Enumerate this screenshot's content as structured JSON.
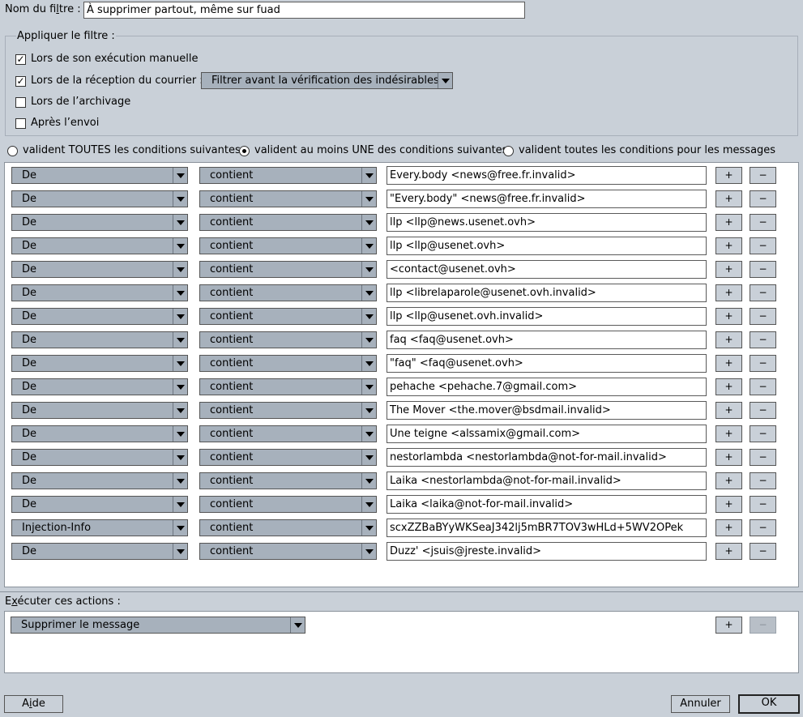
{
  "filter_name": {
    "label": "Nom du filtre :",
    "value": "À supprimer partout, même sur fuad"
  },
  "apply": {
    "title": "Appliquer le filtre :",
    "options": [
      {
        "label": "Lors de son exécution manuelle",
        "checked": true
      },
      {
        "label": "Lors de la réception du courrier :",
        "checked": true
      },
      {
        "label": "Lors de l’archivage",
        "checked": false
      },
      {
        "label": "Après l’envoi",
        "checked": false
      }
    ],
    "reception_mode": "Filtrer avant la vérification des indésirables"
  },
  "match": {
    "options": [
      {
        "label": "valident TOUTES les conditions suivantes",
        "selected": false
      },
      {
        "label": "valident au moins UNE des conditions suivantes",
        "selected": true
      },
      {
        "label": "valident toutes les conditions pour les messages",
        "selected": false
      }
    ]
  },
  "rules": [
    {
      "field": "De",
      "op": "contient",
      "value": "Every.body <news@free.fr.invalid>"
    },
    {
      "field": "De",
      "op": "contient",
      "value": "\"Every.body\" <news@free.fr.invalid>"
    },
    {
      "field": "De",
      "op": "contient",
      "value": "llp <llp@news.usenet.ovh>"
    },
    {
      "field": "De",
      "op": "contient",
      "value": "llp <llp@usenet.ovh>"
    },
    {
      "field": "De",
      "op": "contient",
      "value": "<contact@usenet.ovh>"
    },
    {
      "field": "De",
      "op": "contient",
      "value": "llp <librelaparole@usenet.ovh.invalid>"
    },
    {
      "field": "De",
      "op": "contient",
      "value": "llp <llp@usenet.ovh.invalid>"
    },
    {
      "field": "De",
      "op": "contient",
      "value": "faq <faq@usenet.ovh>"
    },
    {
      "field": "De",
      "op": "contient",
      "value": "\"faq\" <faq@usenet.ovh>"
    },
    {
      "field": "De",
      "op": "contient",
      "value": "pehache <pehache.7@gmail.com>"
    },
    {
      "field": "De",
      "op": "contient",
      "value": "The Mover <the.mover@bsdmail.invalid>"
    },
    {
      "field": "De",
      "op": "contient",
      "value": "Une teigne <alssamix@gmail.com>"
    },
    {
      "field": "De",
      "op": "contient",
      "value": "nestorlambda <nestorlambda@not-for-mail.invalid>"
    },
    {
      "field": "De",
      "op": "contient",
      "value": "Laika <nestorlambda@not-for-mail.invalid>"
    },
    {
      "field": "De",
      "op": "contient",
      "value": "Laika <laika@not-for-mail.invalid>"
    },
    {
      "field": "Injection-Info",
      "op": "contient",
      "value": "scxZZBaBYyWKSeaJ342lj5mBR7TOV3wHLd+5WV2OPek"
    },
    {
      "field": "De",
      "op": "contient",
      "value": "Duzz' <jsuis@jreste.invalid>"
    }
  ],
  "rule_buttons": {
    "add": "+",
    "remove": "−"
  },
  "actions": {
    "title": "Exécuter ces actions :",
    "items": [
      {
        "action": "Supprimer le message"
      }
    ]
  },
  "footer": {
    "help": "Aide",
    "cancel": "Annuler",
    "ok": "OK"
  }
}
